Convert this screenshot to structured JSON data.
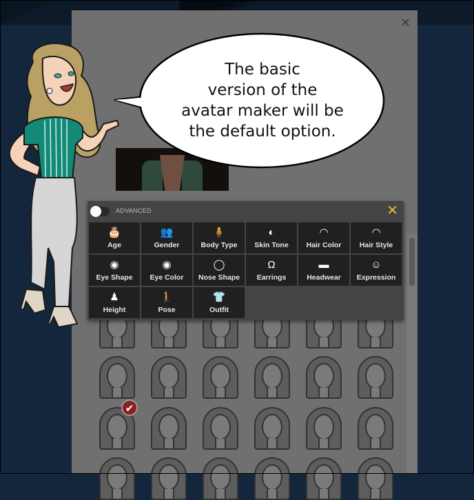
{
  "modal": {
    "close_icon": "✕"
  },
  "speech_bubble": {
    "lines": [
      "The basic",
      "version of the",
      "avatar maker will be",
      "the default option."
    ]
  },
  "options_panel": {
    "toggle_label": "ADVANCED",
    "toggle_state": "off",
    "close_icon": "✕",
    "accent_color": "#e8b93a",
    "items": [
      {
        "label": "Age",
        "icon": "cake-icon",
        "glyph": "🎂"
      },
      {
        "label": "Gender",
        "icon": "gender-icon",
        "glyph": "👥"
      },
      {
        "label": "Body Type",
        "icon": "body-type-icon",
        "glyph": "🧍"
      },
      {
        "label": "Skin Tone",
        "icon": "skin-tone-icon",
        "glyph": "◐"
      },
      {
        "label": "Hair Color",
        "icon": "hair-color-icon",
        "glyph": "◠"
      },
      {
        "label": "Hair Style",
        "icon": "hair-style-icon",
        "glyph": "◠"
      },
      {
        "label": "Eye Shape",
        "icon": "eye-shape-icon",
        "glyph": "◉"
      },
      {
        "label": "Eye Color",
        "icon": "eye-color-icon",
        "glyph": "◉"
      },
      {
        "label": "Nose Shape",
        "icon": "nose-shape-icon",
        "glyph": "◯"
      },
      {
        "label": "Earrings",
        "icon": "earrings-icon",
        "glyph": "Ω"
      },
      {
        "label": "Headwear",
        "icon": "headwear-icon",
        "glyph": "▬"
      },
      {
        "label": "Expression",
        "icon": "expression-icon",
        "glyph": "☺"
      },
      {
        "label": "Height",
        "icon": "height-icon",
        "glyph": "♟"
      },
      {
        "label": "Pose",
        "icon": "pose-icon",
        "glyph": "🚶"
      },
      {
        "label": "Outfit",
        "icon": "outfit-icon",
        "glyph": "👕"
      }
    ]
  },
  "hairstyle_grid": {
    "selected_index": 12,
    "selected_color": "#8c1f22",
    "check_glyph": "✔"
  }
}
